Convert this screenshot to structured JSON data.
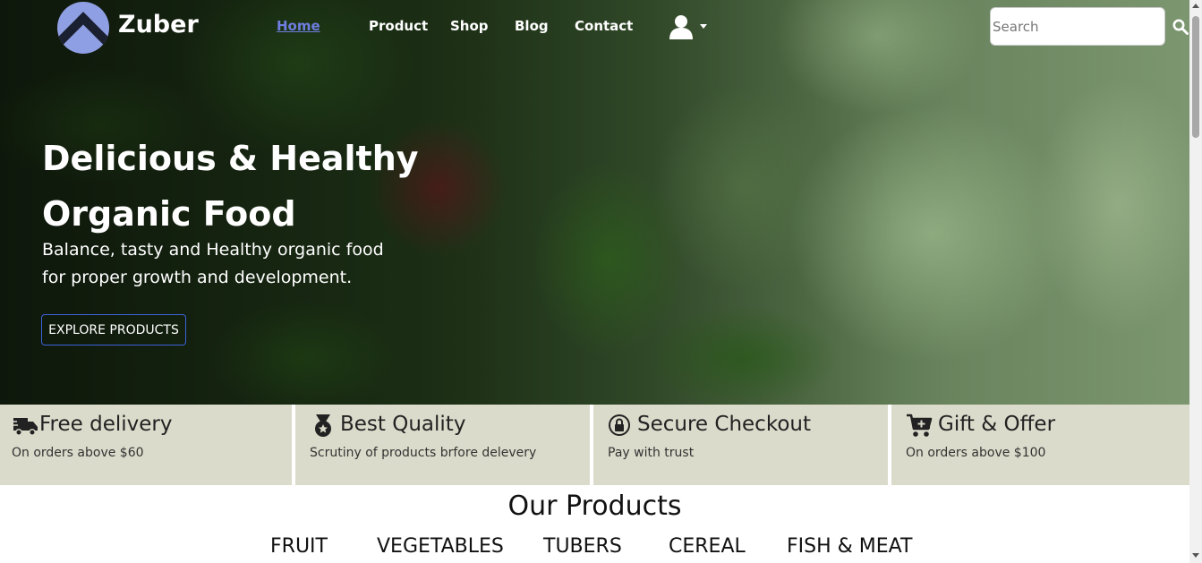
{
  "brand": {
    "name": "Zuber"
  },
  "nav": {
    "items": [
      {
        "label": "Home",
        "active": true
      },
      {
        "label": "Product"
      },
      {
        "label": "Shop"
      },
      {
        "label": "Blog"
      },
      {
        "label": "Contact"
      }
    ]
  },
  "search": {
    "placeholder": "Search",
    "value": ""
  },
  "hero": {
    "title": "Delicious & Healthy Organic Food",
    "subtitle": "Balance, tasty and Healthy organic food for proper growth and development.",
    "cta_label": "EXPLORE PRODUCTS"
  },
  "features": [
    {
      "icon": "delivery-truck-icon",
      "title": "Free delivery",
      "desc": "On orders above $60"
    },
    {
      "icon": "medal-icon",
      "title": "Best Quality",
      "desc": "Scrutiny of products brfore delevery"
    },
    {
      "icon": "lock-icon",
      "title": "Secure Checkout",
      "desc": "Pay with trust"
    },
    {
      "icon": "cart-plus-icon",
      "title": "Gift & Offer",
      "desc": "On orders above $100"
    }
  ],
  "products": {
    "title": "Our Products",
    "categories": [
      "FRUIT",
      "VEGETABLES",
      "TUBERS",
      "CEREAL",
      "FISH & MEAT"
    ]
  },
  "colors": {
    "feature_bg": "#dbdbcc",
    "active_link": "#6f7ee0",
    "logo": "#8f9fe3",
    "cta_border": "#3d63d8"
  }
}
